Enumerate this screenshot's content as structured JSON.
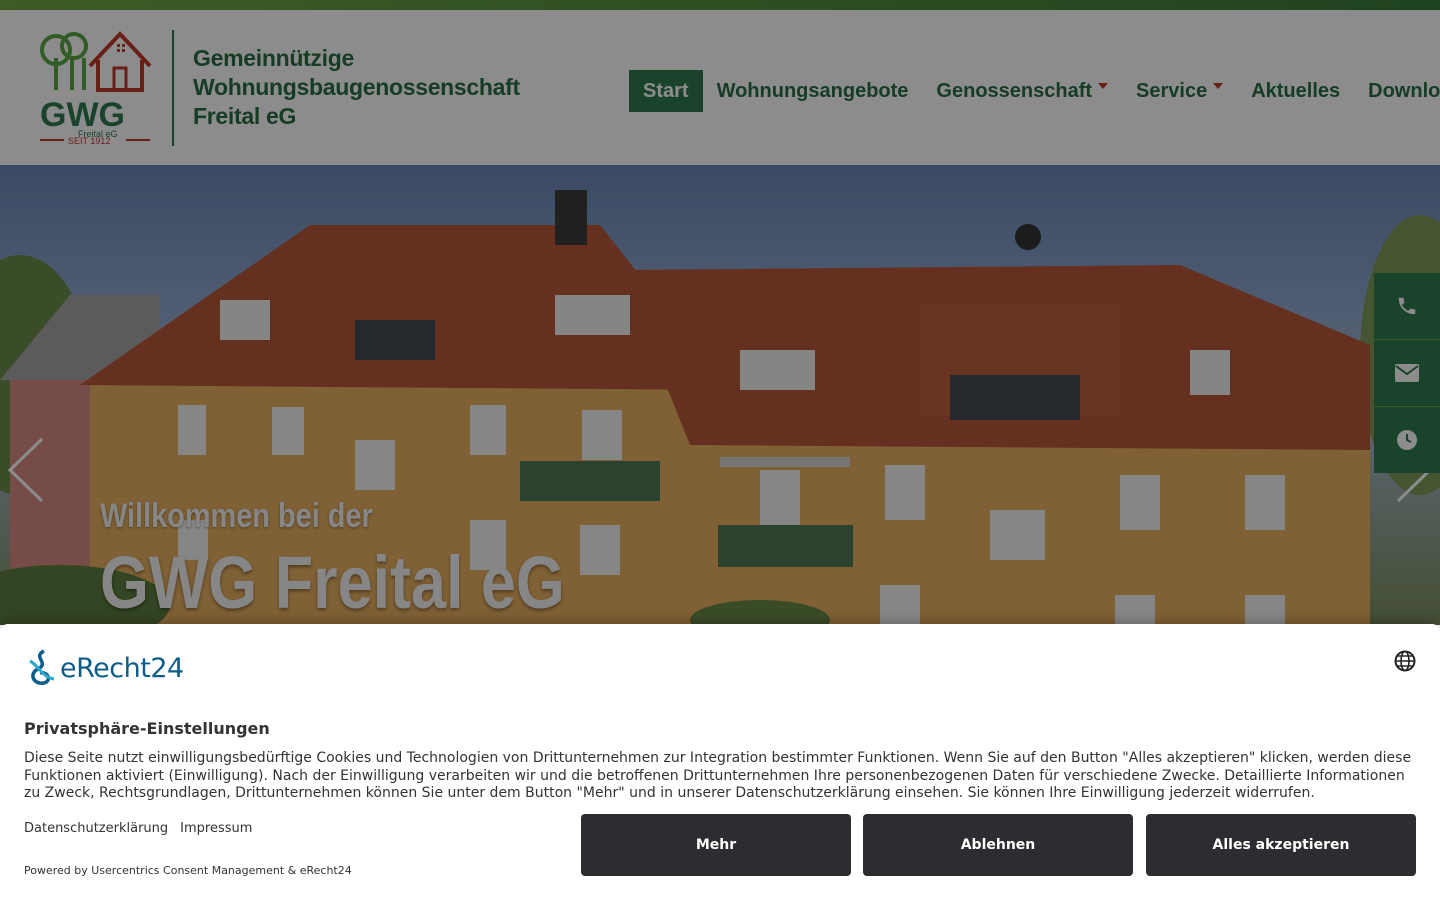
{
  "logo": {
    "mark": "GWG",
    "sub": "Freital eG",
    "since": "SEIT 1912",
    "lines": [
      "Gemeinnützige",
      "Wohnungsbaugenossenschaft",
      "Freital eG"
    ]
  },
  "nav": {
    "items": [
      {
        "label": "Start",
        "active": true
      },
      {
        "label": "Wohnungsangebote"
      },
      {
        "label": "Genossenschaft",
        "dropdown": true
      },
      {
        "label": "Service",
        "dropdown": true
      },
      {
        "label": "Aktuelles"
      },
      {
        "label": "Downloads"
      }
    ]
  },
  "hero": {
    "title_small": "Willkommen bei der",
    "title_big": "GWG Freital eG"
  },
  "side_actions": [
    "phone-icon",
    "envelope-icon",
    "clock-icon"
  ],
  "consent": {
    "brand": "eRecht24",
    "title": "Privatsphäre-Einstellungen",
    "description": "Diese Seite nutzt einwilligungsbedürftige Cookies und Technologien von Drittunternehmen zur Integration bestimmter Funktionen. Wenn Sie auf den Button \"Alles akzeptieren\" klicken, werden diese Funktionen aktiviert (Einwilligung). Nach der Einwilligung verarbeiten wir und die betroffenen Drittunternehmen Ihre personenbezogenen Daten für verschiedene Zwecke. Detaillierte Informationen zu Zweck, Rechtsgrundlagen, Drittunternehmen können Sie unter dem Button \"Mehr\" und in unserer Datenschutzerklärung einsehen. Sie können Ihre Einwilligung jederzeit widerrufen.",
    "links": [
      "Datenschutzerklärung",
      "Impressum"
    ],
    "powered": "Powered by Usercentrics Consent Management & eRecht24",
    "buttons": {
      "more": "Mehr",
      "decline": "Ablehnen",
      "accept": "Alles akzeptieren"
    }
  },
  "colors": {
    "brand_green": "#2e7d4f",
    "brand_red": "#c0392b",
    "button_dark": "#2b2d30"
  }
}
